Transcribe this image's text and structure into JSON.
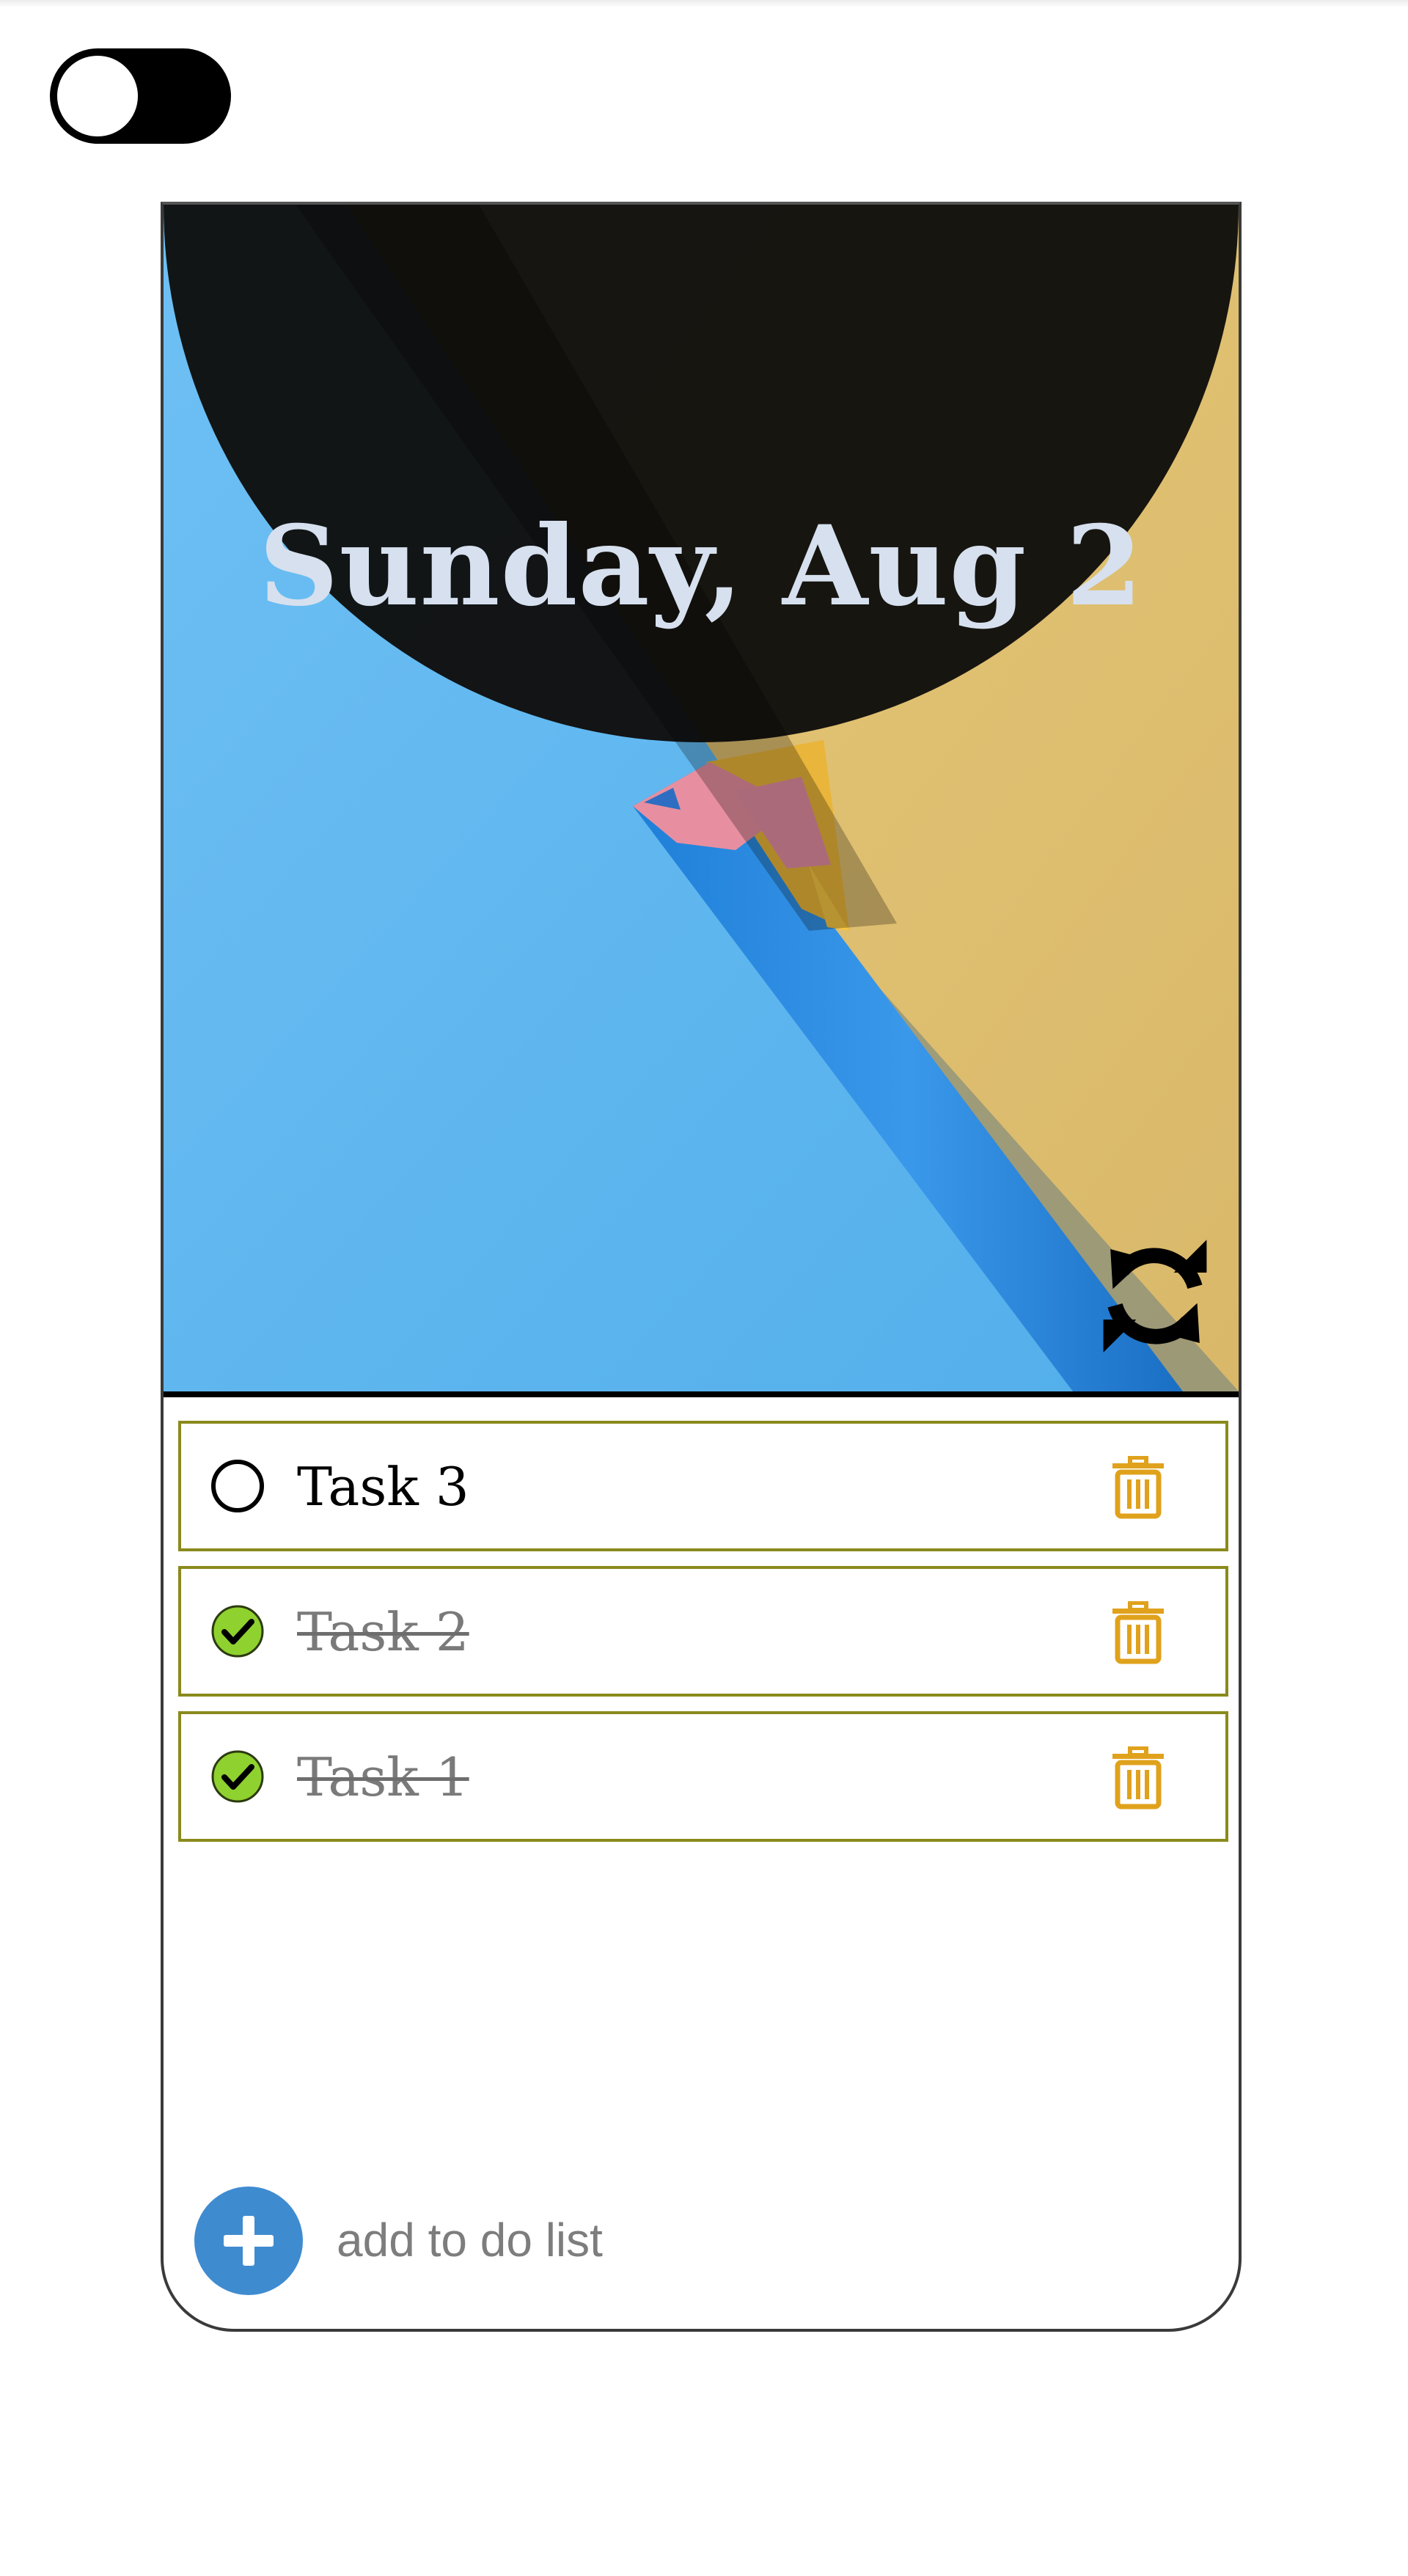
{
  "theme_toggle": {
    "state": "off",
    "icon": "toggle-switch"
  },
  "header": {
    "date": "Sunday, Aug 2",
    "background_image": "blue-and-yellow-pencil-photo",
    "refresh_icon": "refresh-icon"
  },
  "tasks": [
    {
      "label": "Task 3",
      "completed": false
    },
    {
      "label": "Task 2",
      "completed": true
    },
    {
      "label": "Task 1",
      "completed": true
    }
  ],
  "add_bar": {
    "placeholder": "add to do list",
    "value": "",
    "icon": "plus-icon"
  },
  "colors": {
    "accent": "#3f8bd0",
    "task_border": "#8a8a1c",
    "trash": "#e0a21c",
    "check_done": "#8fd12e",
    "date_text": "#d6e0ee"
  }
}
